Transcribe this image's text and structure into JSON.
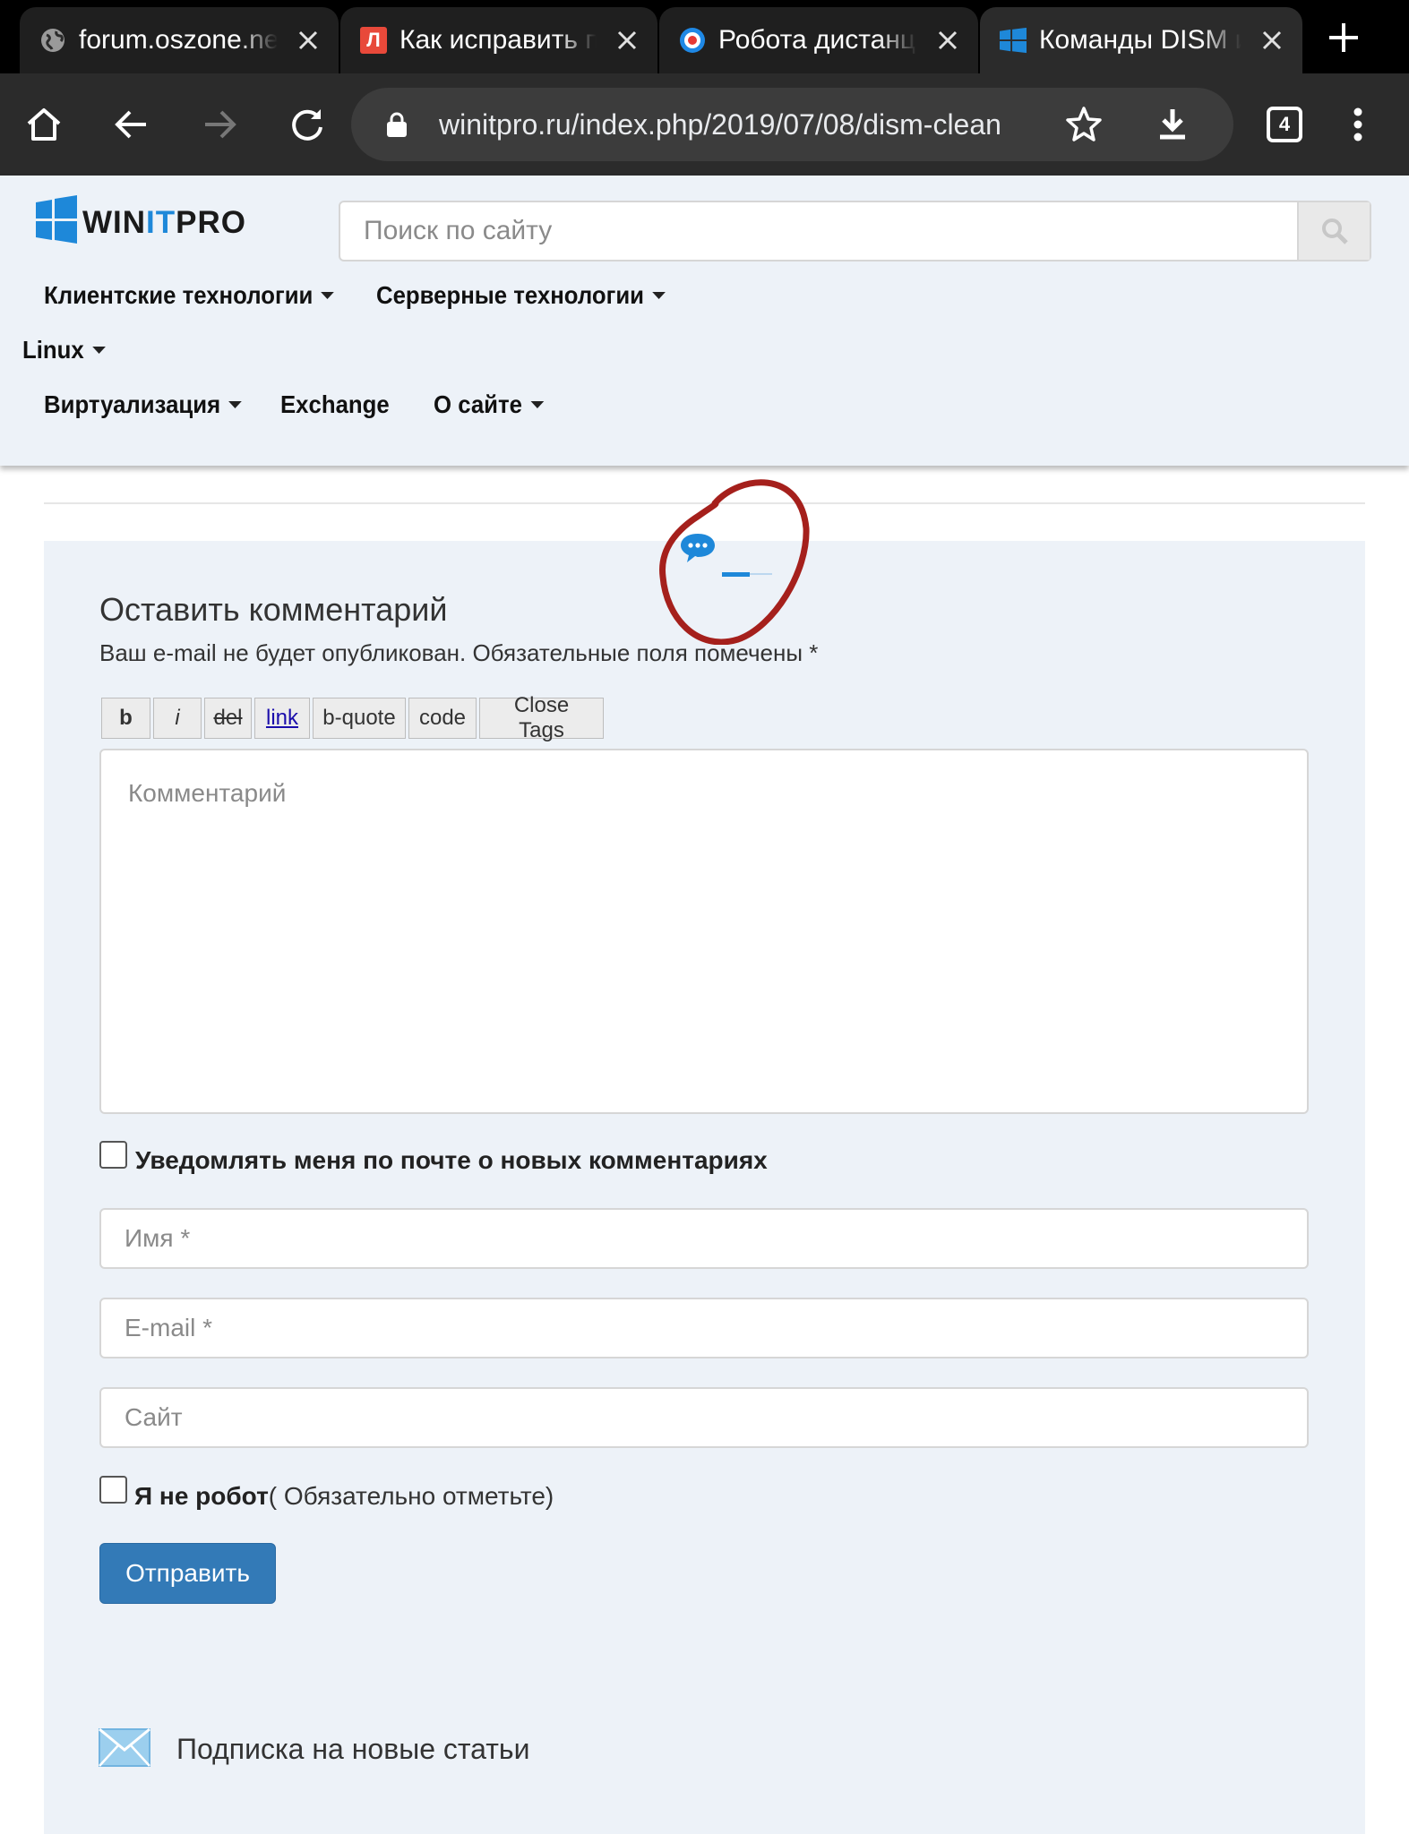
{
  "browser": {
    "tabs": [
      {
        "title": "forum.oszone.net",
        "favicon": "globe-icon",
        "active": false
      },
      {
        "title": "Как исправить п",
        "favicon": "letter-l-icon",
        "favicon_letter": "Л",
        "active": false
      },
      {
        "title": "Робота дистанці",
        "favicon": "target-icon",
        "active": false
      },
      {
        "title": "Команды DISM и",
        "favicon": "windows-icon",
        "active": true
      }
    ],
    "url": "winitpro.ru/index.php/2019/07/08/dism-clean",
    "tab_count": "4",
    "colors": {
      "tabstrip": "#000000",
      "toolbar": "#2b2b2b",
      "omnibox": "#3c3c3c"
    }
  },
  "site": {
    "logo": {
      "part1": "WIN",
      "part2": "IT",
      "part3": "PRO",
      "accent": "#1e88d9"
    },
    "search_placeholder": "Поиск по сайту",
    "nav": {
      "client": "Клиентские технологии",
      "server": "Серверные технологии",
      "linux": "Linux",
      "virtualization": "Виртуализация",
      "exchange": "Exchange",
      "about": "О сайте"
    }
  },
  "comment_form": {
    "title": "Оставить комментарий",
    "note": "Ваш e-mail не будет опубликован. Обязательные поля помечены *",
    "quicktags": {
      "b": "b",
      "i": "i",
      "del": "del",
      "link": "link",
      "bquote": "b-quote",
      "code": "code",
      "close": "Close Tags"
    },
    "comment_placeholder": "Комментарий",
    "notify_label": "Уведомлять меня по почте о новых комментариях",
    "name_placeholder": "Имя *",
    "email_placeholder": "E-mail *",
    "site_placeholder": "Сайт",
    "robot_label_bold": "Я не робот",
    "robot_label_rest": "( Обязательно отметьте)",
    "submit_label": "Отправить",
    "submit_color": "#337ab7",
    "panel_color": "#edf2f8"
  },
  "subscription": {
    "label": "Подписка на новые статьи",
    "icon": "envelope-icon"
  },
  "annotation": {
    "type": "hand-drawn red circle",
    "color": "#a5201c"
  }
}
